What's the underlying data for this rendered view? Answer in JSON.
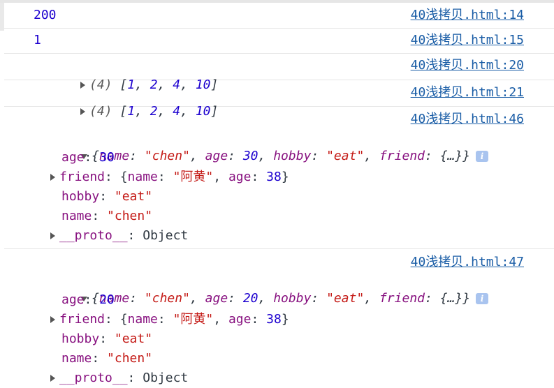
{
  "logs": {
    "r1": {
      "value": "200",
      "source": "40浅拷贝.html:14"
    },
    "r2": {
      "value": "1",
      "source": "40浅拷贝.html:15"
    },
    "r3": {
      "count": "(4)",
      "open": "[",
      "items": [
        "1",
        "2",
        "4",
        "10"
      ],
      "close": "]",
      "source": "40浅拷贝.html:20"
    },
    "r4": {
      "count": "(4)",
      "open": "[",
      "items": [
        "1",
        "2",
        "4",
        "10"
      ],
      "close": "]",
      "source": "40浅拷贝.html:21"
    },
    "r5": {
      "source": "40浅拷贝.html:46",
      "summary": {
        "k_name": "name",
        "v_name": "\"chen\"",
        "k_age": "age",
        "v_age": "30",
        "k_hobby": "hobby",
        "v_hobby": "\"eat\"",
        "k_friend": "friend",
        "v_friend": "{…}"
      },
      "props": {
        "age_key": "age",
        "age_val": "30",
        "friend_key": "friend",
        "friend_name_key": "name",
        "friend_name_val": "\"阿黄\"",
        "friend_age_key": "age",
        "friend_age_val": "38",
        "hobby_key": "hobby",
        "hobby_val": "\"eat\"",
        "name_key": "name",
        "name_val": "\"chen\"",
        "proto_key": "__proto__",
        "proto_val": "Object"
      }
    },
    "r6": {
      "source": "40浅拷贝.html:47",
      "summary": {
        "k_name": "name",
        "v_name": "\"chen\"",
        "k_age": "age",
        "v_age": "20",
        "k_hobby": "hobby",
        "v_hobby": "\"eat\"",
        "k_friend": "friend",
        "v_friend": "{…}"
      },
      "props": {
        "age_key": "age",
        "age_val": "20",
        "friend_key": "friend",
        "friend_name_key": "name",
        "friend_name_val": "\"阿黄\"",
        "friend_age_key": "age",
        "friend_age_val": "38",
        "hobby_key": "hobby",
        "hobby_val": "\"eat\"",
        "name_key": "name",
        "name_val": "\"chen\"",
        "proto_key": "__proto__",
        "proto_val": "Object"
      }
    }
  },
  "icons": {
    "expand": "disclosure-triangle-right",
    "collapse": "disclosure-triangle-down",
    "info": "info-badge"
  },
  "info_glyph": "i",
  "colors": {
    "link": "#1a5da6",
    "number": "#1c00cf",
    "string": "#b01d8f",
    "key": "#881280",
    "divider": "#e6e6e6"
  }
}
